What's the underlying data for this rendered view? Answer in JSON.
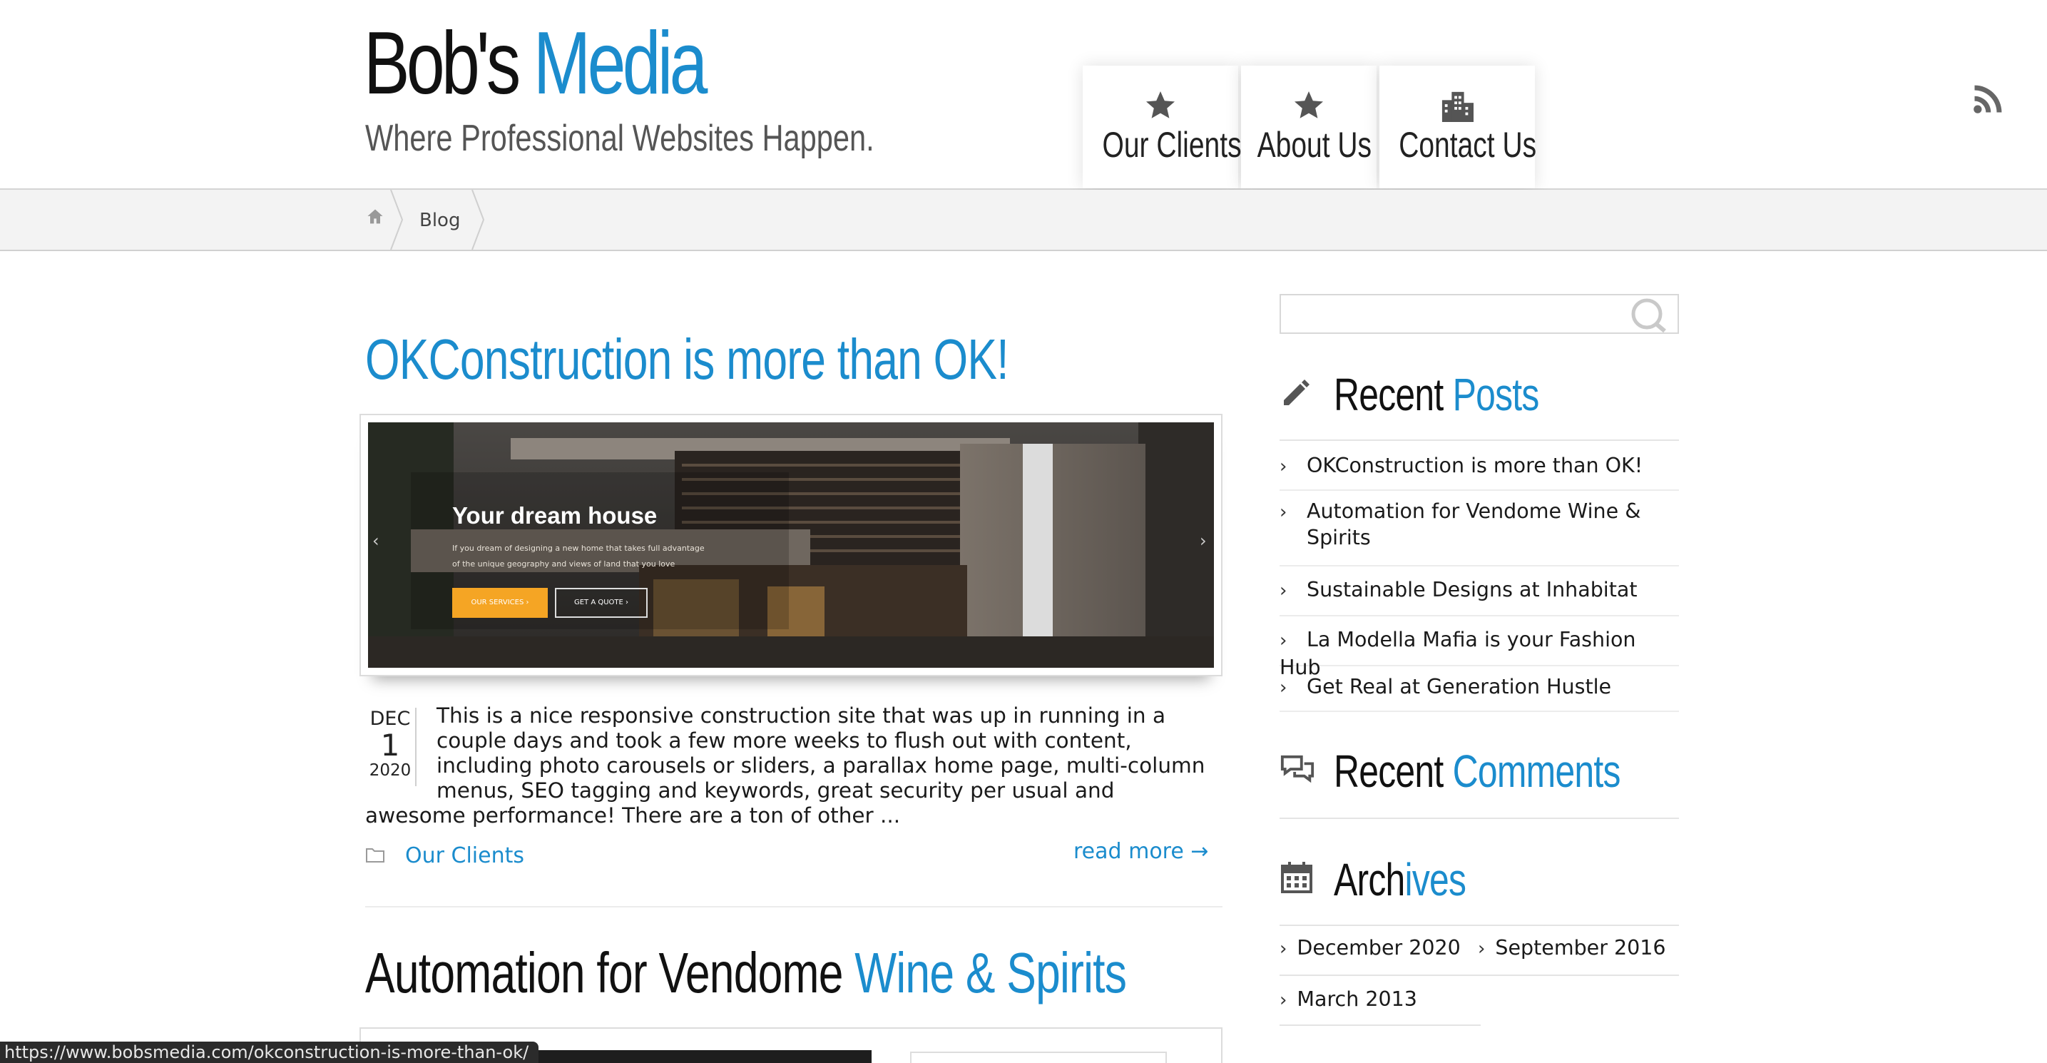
{
  "header": {
    "logo_part1": "Bob's",
    "logo_part2": "Media",
    "tagline": "Where Professional Websites Happen.",
    "nav": [
      {
        "label": "Our Clients",
        "icon": "star-icon"
      },
      {
        "label": "About Us",
        "icon": "star-icon"
      },
      {
        "label": "Contact Us",
        "icon": "building-icon"
      }
    ],
    "rss_icon": "rss-icon"
  },
  "breadcrumb": {
    "home_icon": "home-icon",
    "current": "Blog"
  },
  "posts": [
    {
      "title": "OKConstruction is more than OK!",
      "image": {
        "headline": "Your dream house",
        "body_line1": "If you dream of designing a new home that takes full advantage",
        "body_line2": "of the unique geography and views of land that you love",
        "btn_primary": "OUR SERVICES ›",
        "btn_secondary": "GET A QUOTE ›",
        "prev_arrow": "‹",
        "next_arrow": "›"
      },
      "date": {
        "month": "DEC",
        "day": "1",
        "year": "2020"
      },
      "excerpt": "This is a nice responsive construction site that was up in running in a couple days and took a few more weeks to flush out with content, including photo carousels or sliders, a parallax home page, multi-column menus, SEO tagging and keywords, great security per usual and awesome performance! There are a ton of other ...",
      "category": "Our Clients",
      "read_more": "read more →"
    },
    {
      "title_part1": "Automation for Vendome",
      "title_part2": "Wine & Spirits"
    }
  ],
  "sidebar": {
    "search_placeholder": "",
    "recent_posts": {
      "title_a": "Recent",
      "title_b": "Posts",
      "items": [
        "OKConstruction is more than OK!",
        "Automation for Vendome Wine & Spirits",
        "Sustainable Designs at Inhabitat",
        "La Modella Mafia is your Fashion Hub",
        "Get Real at Generation Hustle"
      ]
    },
    "recent_comments": {
      "title_a": "Recent",
      "title_b": "Comments"
    },
    "archives": {
      "title_a": "Arch",
      "title_b": "ives",
      "items": [
        "December 2020",
        "September 2016",
        "March 2013"
      ]
    }
  },
  "status_bar": {
    "url": "https://www.bobsmedia.com/okconstruction-is-more-than-ok/"
  },
  "colors": {
    "accent": "#1b8ccd",
    "text": "#111111",
    "muted": "#555555",
    "border": "#dcdcdc"
  }
}
